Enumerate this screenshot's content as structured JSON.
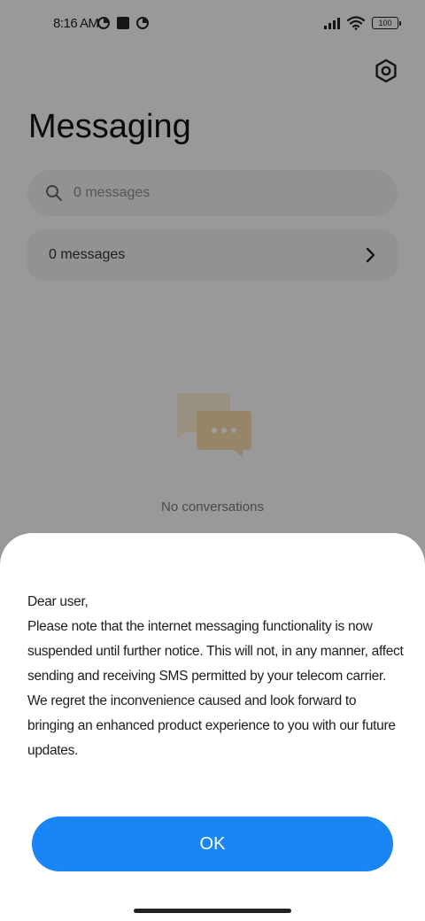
{
  "status_bar": {
    "time": "8:16 AM",
    "battery": "100"
  },
  "header": {
    "title": "Messaging"
  },
  "search": {
    "placeholder": "0 messages"
  },
  "messages_row": {
    "label": "0 messages"
  },
  "empty_state": {
    "text": "No conversations"
  },
  "dialog": {
    "lines": [
      "Dear user,",
      "Please note that the internet messaging functionality is now suspended until further notice. This will not, in any manner, affect sending and receiving SMS permitted by your telecom carrier. We regret the inconvenience caused and look forward to bringing an enhanced product experience to you with our future updates."
    ],
    "ok_label": "OK"
  },
  "colors": {
    "accent": "#1a86f5",
    "illustration": "#f3d9a6"
  }
}
